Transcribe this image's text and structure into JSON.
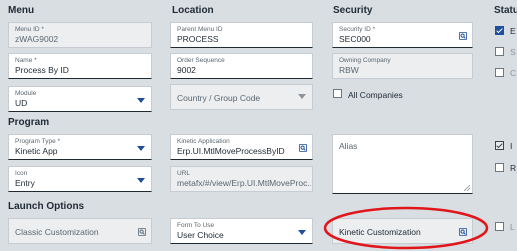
{
  "sections": {
    "menu": "Menu",
    "location": "Location",
    "security": "Security",
    "status": "Status",
    "program": "Program",
    "launch_options": "Launch Options"
  },
  "fields": {
    "menu_id": {
      "label": "Menu ID *",
      "value": "zWAG9002"
    },
    "parent_menu_id": {
      "label": "Parent Menu ID",
      "value": "PROCESS"
    },
    "security_id": {
      "label": "Security ID *",
      "value": "SEC000"
    },
    "name": {
      "label": "Name *",
      "value": "Process By ID"
    },
    "order_sequence": {
      "label": "Order Sequence",
      "value": "9002"
    },
    "owning_company": {
      "label": "Owning Company",
      "value": "RBW"
    },
    "module": {
      "label": "Module",
      "value": "UD"
    },
    "country_group_code": {
      "placeholder": "Country / Group Code"
    },
    "program_type": {
      "label": "Program Type *",
      "value": "Kinetic App"
    },
    "kinetic_application": {
      "label": "Kinetic Application",
      "value": "Erp.UI.MtlMoveProcessByID"
    },
    "alias": {
      "placeholder": "Alias"
    },
    "icon": {
      "label": "Icon",
      "value": "Entry"
    },
    "url": {
      "label": "URL",
      "value": "metafx/#/view/Erp.UI.MtlMoveProc..."
    },
    "classic_customization": {
      "placeholder": "Classic Customization"
    },
    "form_to_use": {
      "label": "Form To Use",
      "value": "User Choice"
    },
    "kinetic_customization": {
      "placeholder": "Kinetic Customization"
    }
  },
  "checkboxes": {
    "all_companies": {
      "label": "All Companies",
      "checked": false
    },
    "status_1": {
      "label": "E",
      "checked": true
    },
    "status_2": {
      "label": "S",
      "checked": false
    },
    "status_3": {
      "label": "C",
      "checked": false
    },
    "status_4": {
      "label": "I",
      "checked": true
    },
    "status_5": {
      "label": "R",
      "checked": false
    },
    "status_6": {
      "label": "L",
      "checked": false
    }
  },
  "colors": {
    "accent": "#1f4e9c",
    "annotation": "#e0161b",
    "background": "#d9dee3"
  },
  "icons": [
    "search-icon",
    "chevron-down-icon",
    "checkbox-icon",
    "resize-handle-icon"
  ]
}
